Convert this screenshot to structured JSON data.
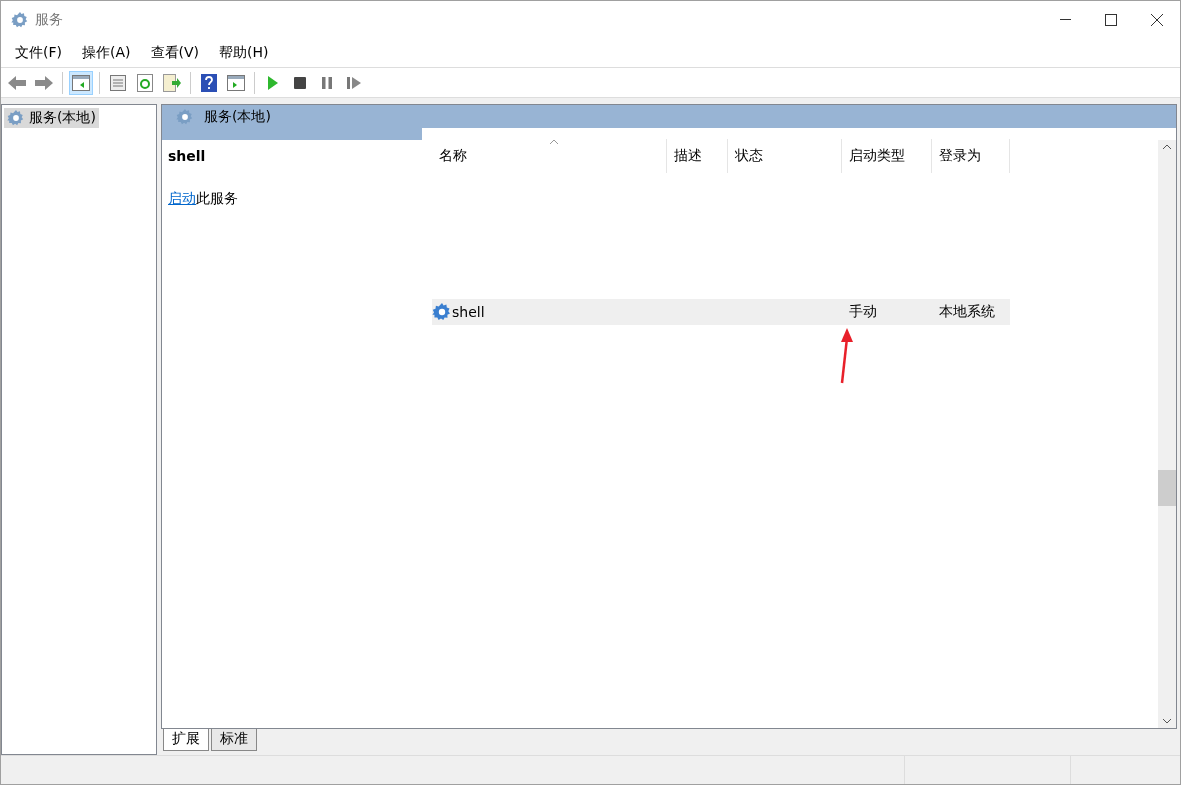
{
  "window": {
    "title": "服务"
  },
  "menu": [
    "文件(F)",
    "操作(A)",
    "查看(V)",
    "帮助(H)"
  ],
  "toolbar": [
    {
      "kind": "back",
      "selected": false
    },
    {
      "kind": "forward",
      "selected": false
    },
    {
      "kind": "sep"
    },
    {
      "kind": "tree",
      "selected": true
    },
    {
      "kind": "sep"
    },
    {
      "kind": "properties",
      "selected": false
    },
    {
      "kind": "refresh",
      "selected": false
    },
    {
      "kind": "export",
      "selected": false
    },
    {
      "kind": "sep"
    },
    {
      "kind": "help",
      "selected": false
    },
    {
      "kind": "actionpane",
      "selected": false
    },
    {
      "kind": "sep"
    },
    {
      "kind": "play",
      "selected": false
    },
    {
      "kind": "stop",
      "selected": false
    },
    {
      "kind": "pause",
      "selected": false
    },
    {
      "kind": "resume",
      "selected": false
    }
  ],
  "tree": [
    {
      "label": "服务(本地)",
      "selected": true
    }
  ],
  "pane": {
    "title": "服务(本地)",
    "service_name": "shell",
    "action_link": "启动",
    "action_rest": "此服务"
  },
  "table": {
    "columns": [
      "名称",
      "描述",
      "状态",
      "启动类型",
      "登录为"
    ],
    "rows": [
      {
        "cells": [
          "shell",
          "",
          "",
          "手动",
          "本地系统"
        ],
        "selected": true
      }
    ]
  },
  "tabs": [
    {
      "label": "扩展",
      "selected": true
    },
    {
      "label": "标准",
      "selected": false
    }
  ]
}
